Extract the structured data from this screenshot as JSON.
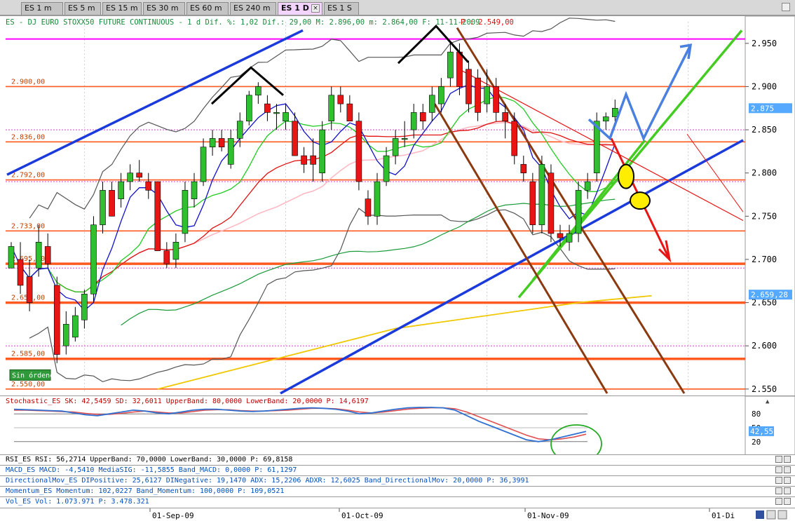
{
  "tabs": [
    {
      "label": "ES 1 m",
      "active": false
    },
    {
      "label": "ES 5 m",
      "active": false
    },
    {
      "label": "ES 15 m",
      "active": false
    },
    {
      "label": "ES 30 m",
      "active": false
    },
    {
      "label": "ES 60 m",
      "active": false
    },
    {
      "label": "ES 240 m",
      "active": false
    },
    {
      "label": "ES 1 D",
      "active": true
    },
    {
      "label": "ES 1 S",
      "active": false
    }
  ],
  "header": {
    "part1": "ES - DJ EURO STOXX50 FUTURE CONTINUOUS -  1 d Dif. %: 1,02 Dif.: 29,00 M: 2.896,00 m: 2.864,00 F: 11-11-2009",
    "part2": "P : 2.549,00"
  },
  "order_button": "Sin órdenes",
  "colors": {
    "up": "#2fbf2f",
    "down": "#e81515",
    "accent": "#ff00ff",
    "bg_tab_active": "#f3d3ff"
  },
  "chart_data": {
    "type": "candlestick",
    "symbol": "ES",
    "interval": "1 D",
    "ylim": [
      2545,
      2975
    ],
    "y_ticks": [
      2550,
      2600,
      2650,
      2700,
      2750,
      2800,
      2850,
      2900,
      2950
    ],
    "y_tick_labels": [
      "2.550",
      "2.600",
      "2.650",
      "2.700",
      "2.750",
      "2.800",
      "2.850",
      "2.900",
      "2.950"
    ],
    "x_labels": [
      "01-Sep-09",
      "01-Oct-09",
      "01-Nov-09",
      "01-Di"
    ],
    "x_label_dates": [
      "2009-09-01",
      "2009-10-01",
      "2009-11-01",
      "2009-12-01"
    ],
    "candles": [
      [
        "2009-08-20",
        2690,
        2715,
        2690,
        2720
      ],
      [
        "2009-08-21",
        2700,
        2670,
        2720,
        2660
      ],
      [
        "2009-08-24",
        2680,
        2650,
        2700,
        2640
      ],
      [
        "2009-08-25",
        2690,
        2720,
        2680,
        2740
      ],
      [
        "2009-08-26",
        2715,
        2695,
        2730,
        2690
      ],
      [
        "2009-08-27",
        2670,
        2590,
        2680,
        2580
      ],
      [
        "2009-08-28",
        2600,
        2625,
        2590,
        2640
      ],
      [
        "2009-08-31",
        2610,
        2635,
        2605,
        2645
      ],
      [
        "2009-09-01",
        2630,
        2660,
        2620,
        2665
      ],
      [
        "2009-09-02",
        2660,
        2740,
        2650,
        2750
      ],
      [
        "2009-09-03",
        2740,
        2780,
        2730,
        2790
      ],
      [
        "2009-09-04",
        2780,
        2750,
        2760,
        2790
      ],
      [
        "2009-09-07",
        2770,
        2790,
        2760,
        2800
      ],
      [
        "2009-09-08",
        2790,
        2800,
        2780,
        2810
      ],
      [
        "2009-09-09",
        2800,
        2795,
        2790,
        2815
      ],
      [
        "2009-09-10",
        2790,
        2780,
        2770,
        2800
      ],
      [
        "2009-09-11",
        2790,
        2710,
        2780,
        2720
      ],
      [
        "2009-09-14",
        2710,
        2695,
        2690,
        2720
      ],
      [
        "2009-09-15",
        2700,
        2720,
        2690,
        2730
      ],
      [
        "2009-09-16",
        2730,
        2780,
        2720,
        2790
      ],
      [
        "2009-09-17",
        2770,
        2790,
        2760,
        2800
      ],
      [
        "2009-09-18",
        2790,
        2830,
        2785,
        2840
      ],
      [
        "2009-09-21",
        2830,
        2840,
        2820,
        2850
      ],
      [
        "2009-09-22",
        2840,
        2830,
        2825,
        2850
      ],
      [
        "2009-09-23",
        2810,
        2840,
        2805,
        2850
      ],
      [
        "2009-09-24",
        2840,
        2860,
        2830,
        2870
      ],
      [
        "2009-09-25",
        2860,
        2890,
        2855,
        2895
      ],
      [
        "2009-09-28",
        2890,
        2900,
        2880,
        2905
      ],
      [
        "2009-09-29",
        2880,
        2870,
        2860,
        2890
      ],
      [
        "2009-09-30",
        2870,
        2870,
        2850,
        2880
      ],
      [
        "2009-10-01",
        2860,
        2870,
        2850,
        2880
      ],
      [
        "2009-10-02",
        2860,
        2820,
        2820,
        2870
      ],
      [
        "2009-10-05",
        2820,
        2810,
        2800,
        2830
      ],
      [
        "2009-10-06",
        2820,
        2810,
        2790,
        2840
      ],
      [
        "2009-10-07",
        2800,
        2850,
        2790,
        2860
      ],
      [
        "2009-10-08",
        2860,
        2890,
        2850,
        2900
      ],
      [
        "2009-10-09",
        2890,
        2880,
        2870,
        2900
      ],
      [
        "2009-10-12",
        2880,
        2860,
        2860,
        2890
      ],
      [
        "2009-10-13",
        2860,
        2790,
        2780,
        2870
      ],
      [
        "2009-10-14",
        2770,
        2750,
        2740,
        2780
      ],
      [
        "2009-10-15",
        2750,
        2790,
        2740,
        2800
      ],
      [
        "2009-10-16",
        2790,
        2820,
        2785,
        2830
      ],
      [
        "2009-10-19",
        2820,
        2840,
        2810,
        2850
      ],
      [
        "2009-10-20",
        2840,
        2840,
        2830,
        2860
      ],
      [
        "2009-10-21",
        2850,
        2870,
        2840,
        2880
      ],
      [
        "2009-10-22",
        2870,
        2860,
        2850,
        2880
      ],
      [
        "2009-10-23",
        2870,
        2890,
        2860,
        2900
      ],
      [
        "2009-10-26",
        2880,
        2900,
        2870,
        2910
      ],
      [
        "2009-10-27",
        2910,
        2940,
        2900,
        2950
      ],
      [
        "2009-10-28",
        2940,
        2900,
        2890,
        2950
      ],
      [
        "2009-10-29",
        2920,
        2880,
        2870,
        2930
      ],
      [
        "2009-10-30",
        2910,
        2870,
        2860,
        2920
      ],
      [
        "2009-11-02",
        2880,
        2900,
        2870,
        2920
      ],
      [
        "2009-11-03",
        2900,
        2870,
        2860,
        2910
      ],
      [
        "2009-11-04",
        2870,
        2860,
        2840,
        2880
      ],
      [
        "2009-11-05",
        2860,
        2820,
        2810,
        2870
      ],
      [
        "2009-11-06",
        2810,
        2800,
        2790,
        2820
      ],
      [
        "2009-11-09",
        2790,
        2740,
        2730,
        2800
      ],
      [
        "2009-11-10",
        2740,
        2810,
        2730,
        2820
      ],
      [
        "2009-11-11",
        2800,
        2730,
        2720,
        2810
      ],
      [
        "2009-11-12",
        2730,
        2725,
        2715,
        2740
      ],
      [
        "2009-11-13",
        2720,
        2730,
        2710,
        2740
      ],
      [
        "2009-11-16",
        2730,
        2780,
        2720,
        2790
      ],
      [
        "2009-11-17",
        2780,
        2790,
        2770,
        2800
      ],
      [
        "2009-11-18",
        2800,
        2860,
        2790,
        2870
      ],
      [
        "2009-11-19",
        2860,
        2865,
        2850,
        2870
      ],
      [
        "2009-11-20",
        2865,
        2875,
        2860,
        2885
      ]
    ],
    "candle_fields": [
      "date",
      "open",
      "close",
      "low",
      "high"
    ],
    "horizontal_levels": [
      {
        "value": 2955,
        "color": "#ff00ff",
        "label": ""
      },
      {
        "value": 2900,
        "color": "#ff5a20",
        "label": "2.900,00"
      },
      {
        "value": 2836,
        "color": "#ff5a20",
        "label": "2.836,00"
      },
      {
        "value": 2792,
        "color": "#ff5a20",
        "label": "2.792,00"
      },
      {
        "value": 2733,
        "color": "#ff5a20",
        "label": "2.733,00"
      },
      {
        "value": 2695,
        "color": "#ff5a20",
        "label": "2.695,00"
      },
      {
        "value": 2650,
        "color": "#ff5a20",
        "label": "2.650,00"
      },
      {
        "value": 2585,
        "color": "#ff5a20",
        "label": "2.585,00"
      },
      {
        "value": 2550,
        "color": "#ff5a20",
        "label": "2.550,00"
      }
    ],
    "price_tags": [
      {
        "value": 2875,
        "label": "2.875",
        "color": "#ffffff",
        "bg": "#55aaff"
      },
      {
        "value": 2659.28,
        "label": "2.659,28",
        "color": "#ffffff",
        "bg": "#55aaff"
      }
    ],
    "stochastic": {
      "header": "Stochastic_ES SK: 42,5459 SD: 32,6011 UpperBand: 80,0000 LowerBand: 20,0000 P: 14,6197",
      "upper": 80,
      "lower": 20,
      "ticks": [
        "80",
        "50",
        "20"
      ],
      "tag": "42,55"
    },
    "indicators": [
      "RSI_ES RSI: 56,2714 UpperBand: 70,0000 LowerBand: 30,0000 P: 69,8158",
      "MACD_ES MACD: -4,5410 MediaSIG: -11,5855 Band_MACD: 0,0000 P: 61,1297",
      "DirectionalMov_ES DIPositive: 25,6127 DINegative: 19,1470 ADX: 15,2206 ADXR: 12,6025 Band_DirectionalMov: 20,0000 P: 36,3991",
      "Momentum_ES Momentum: 102,0227 Band_Momentum: 100,0000 P: 109,0521",
      "Vol_ES Vol: 1.073.971 P: 3.478.321"
    ]
  }
}
